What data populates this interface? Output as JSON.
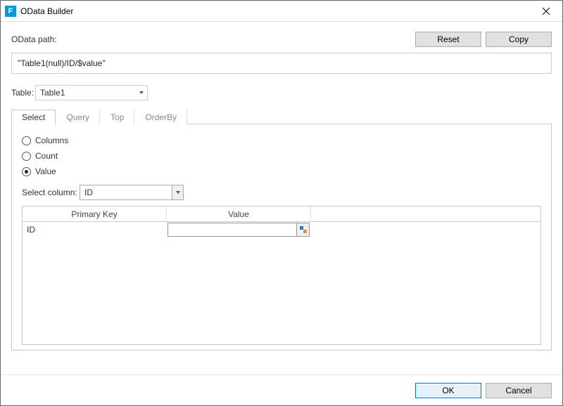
{
  "window": {
    "title": "OData Builder",
    "app_letter": "F"
  },
  "header": {
    "path_label": "OData path:",
    "reset_label": "Reset",
    "copy_label": "Copy",
    "path_value": "\"Table1(null)/ID/$value\""
  },
  "table_row": {
    "label": "Table:",
    "value": "Table1"
  },
  "tabs": [
    "Select",
    "Query",
    "Top",
    "OrderBy"
  ],
  "active_tab": "Select",
  "select_panel": {
    "radio_columns": "Columns",
    "radio_count": "Count",
    "radio_value": "Value",
    "selected_radio": "Value",
    "select_column_label": "Select column:",
    "select_column_value": "ID",
    "grid": {
      "col_pk": "Primary Key",
      "col_val": "Value",
      "rows": [
        {
          "pk": "ID",
          "value": ""
        }
      ]
    }
  },
  "footer": {
    "ok": "OK",
    "cancel": "Cancel"
  }
}
